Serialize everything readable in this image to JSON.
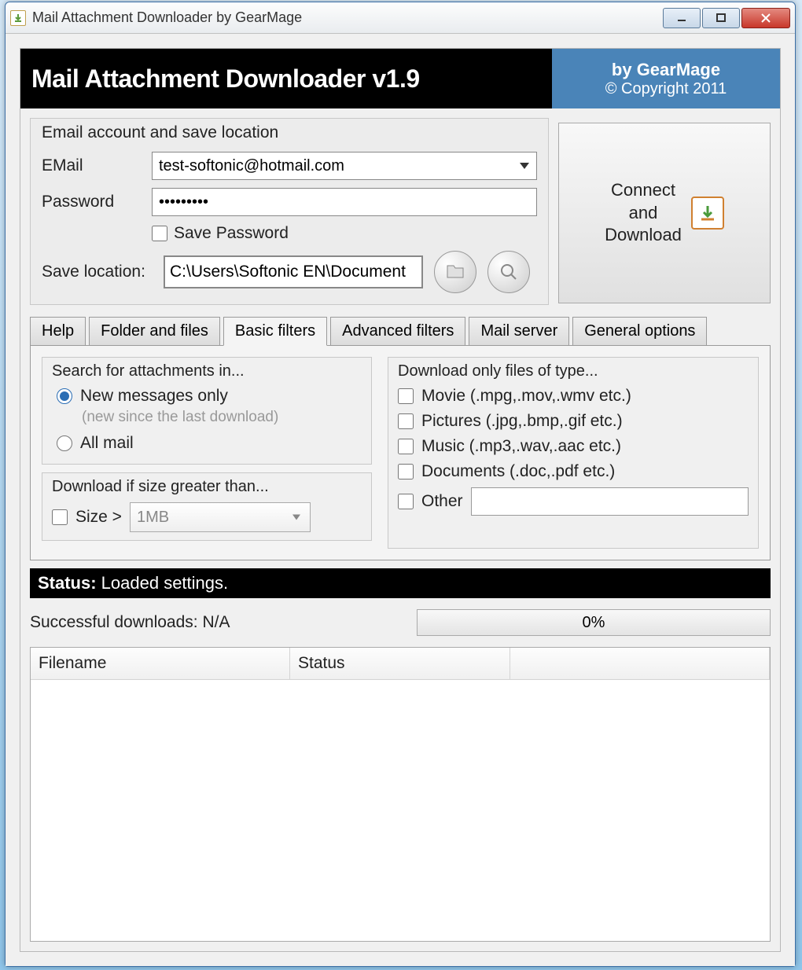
{
  "window": {
    "title": "Mail Attachment Downloader by GearMage"
  },
  "banner": {
    "title": "Mail Attachment Downloader v1.9",
    "by": "by GearMage",
    "copyright": "© Copyright 2011"
  },
  "account": {
    "group_title": "Email account and save location",
    "email_label": "EMail",
    "email_value": "test-softonic@hotmail.com",
    "password_label": "Password",
    "password_value": "•••••••••",
    "save_password_label": "Save Password",
    "save_location_label": "Save location:",
    "save_location_value": "C:\\Users\\Softonic EN\\Document"
  },
  "connect": {
    "label": "Connect\nand\nDownload"
  },
  "tabs": {
    "help": "Help",
    "folder": "Folder and files",
    "basic": "Basic filters",
    "advanced": "Advanced filters",
    "server": "Mail server",
    "general": "General options"
  },
  "filters": {
    "search_title": "Search for attachments in...",
    "radio_new": "New messages only",
    "radio_new_hint": "(new since the last download)",
    "radio_all": "All mail",
    "size_title": "Download if size greater than...",
    "size_check": "Size >",
    "size_value": "1MB",
    "type_title": "Download only files of type...",
    "type_movie": "Movie (.mpg,.mov,.wmv etc.)",
    "type_pictures": "Pictures (.jpg,.bmp,.gif etc.)",
    "type_music": "Music (.mp3,.wav,.aac etc.)",
    "type_docs": "Documents (.doc,.pdf etc.)",
    "type_other": "Other"
  },
  "status": {
    "label": "Status:",
    "text": " Loaded settings."
  },
  "downloads": {
    "label": "Successful downloads: N/A",
    "progress": "0%"
  },
  "table": {
    "col1": "Filename",
    "col2": "Status"
  }
}
